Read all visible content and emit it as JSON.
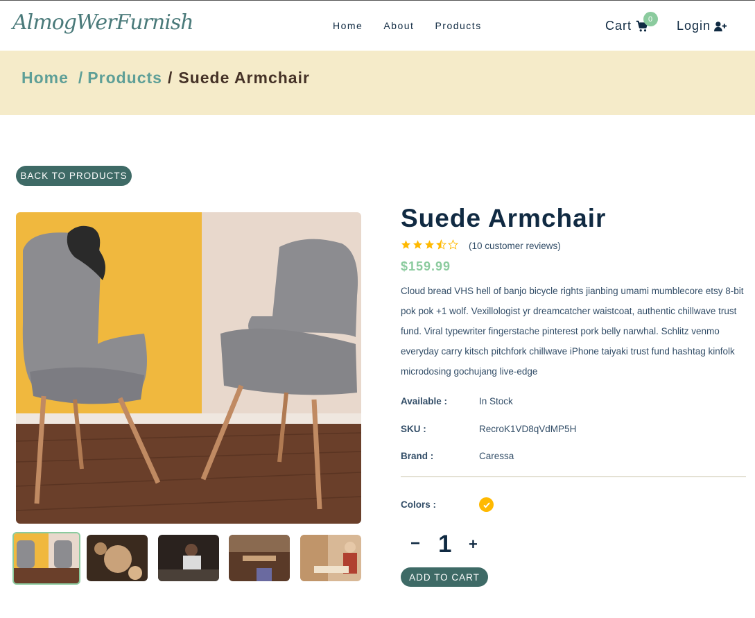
{
  "nav": {
    "logo": "AlmogWerFurnish",
    "links": [
      "Home",
      "About",
      "Products"
    ],
    "cart_label": "Cart",
    "cart_count": "0",
    "login_label": "Login"
  },
  "breadcrumb": {
    "home": "Home",
    "products": "Products",
    "current": "Suede Armchair"
  },
  "back_button": "BACK TO PRODUCTS",
  "product": {
    "name": "Suede Armchair",
    "rating": 3.5,
    "reviews": "(10 customer reviews)",
    "price": "$159.99",
    "description": "Cloud bread VHS hell of banjo bicycle rights jianbing umami mumblecore etsy 8-bit pok pok +1 wolf. Vexillologist yr dreamcatcher waistcoat, authentic chillwave trust fund. Viral typewriter fingerstache pinterest pork belly narwhal. Schlitz venmo everyday carry kitsch pitchfork chillwave iPhone taiyaki trust fund hashtag kinfolk microdosing gochujang live-edge",
    "available_label": "Available :",
    "available_value": "In Stock",
    "sku_label": "SKU :",
    "sku_value": "RecroK1VD8qVdMP5H",
    "brand_label": "Brand :",
    "brand_value": "Caressa",
    "colors_label": "Colors :",
    "color_selected": "#ffb900",
    "quantity": "1",
    "minus": "−",
    "plus": "+",
    "add_to_cart": "ADD TO CART"
  },
  "theme": {
    "accent": "#3e6a66",
    "green": "#8bcb9e",
    "hero_bg": "#f5ebc9",
    "star": "#ffb900"
  }
}
